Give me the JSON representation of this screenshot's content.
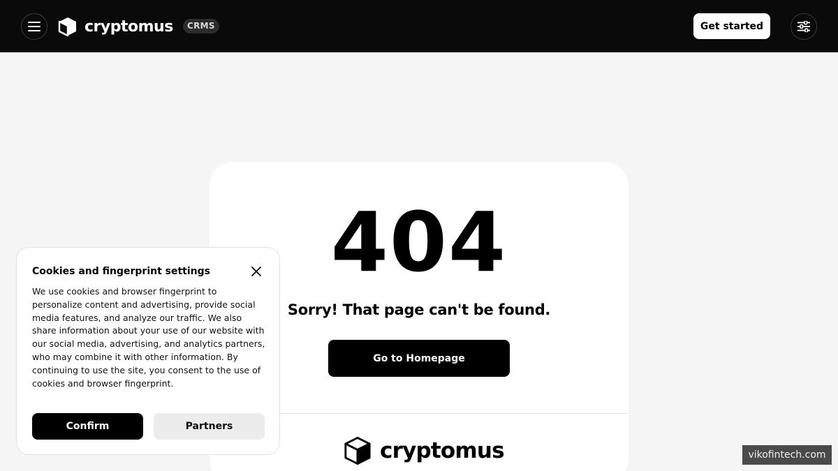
{
  "header": {
    "brand_name": "cryptomus",
    "product_badge": "CRMS",
    "get_started_label": "Get started",
    "menu_icon": "hamburger-menu-icon",
    "settings_icon": "sliders-icon"
  },
  "error": {
    "code": "404",
    "message": "Sorry! That page can't be found.",
    "home_button_label": "Go to Homepage"
  },
  "footer": {
    "brand_name": "cryptomus"
  },
  "cookie_banner": {
    "title": "Cookies and fingerprint settings",
    "body": "We use cookies and browser fingerprint to personalize content and advertising, provide social media features, and analyze our traffic. We also share information about your use of our website with our social media, advertising, and analytics partners, who may combine it with other information. By continuing to use the site, you consent to the use of cookies and browser fingerprint.",
    "confirm_label": "Confirm",
    "partners_label": "Partners",
    "close_icon": "close-icon"
  },
  "watermark": "vikofintech.com",
  "colors": {
    "header_bg": "#0a0a0a",
    "page_bg": "#f5f5f5",
    "primary_button": "#000000",
    "secondary_button": "#ececec"
  }
}
